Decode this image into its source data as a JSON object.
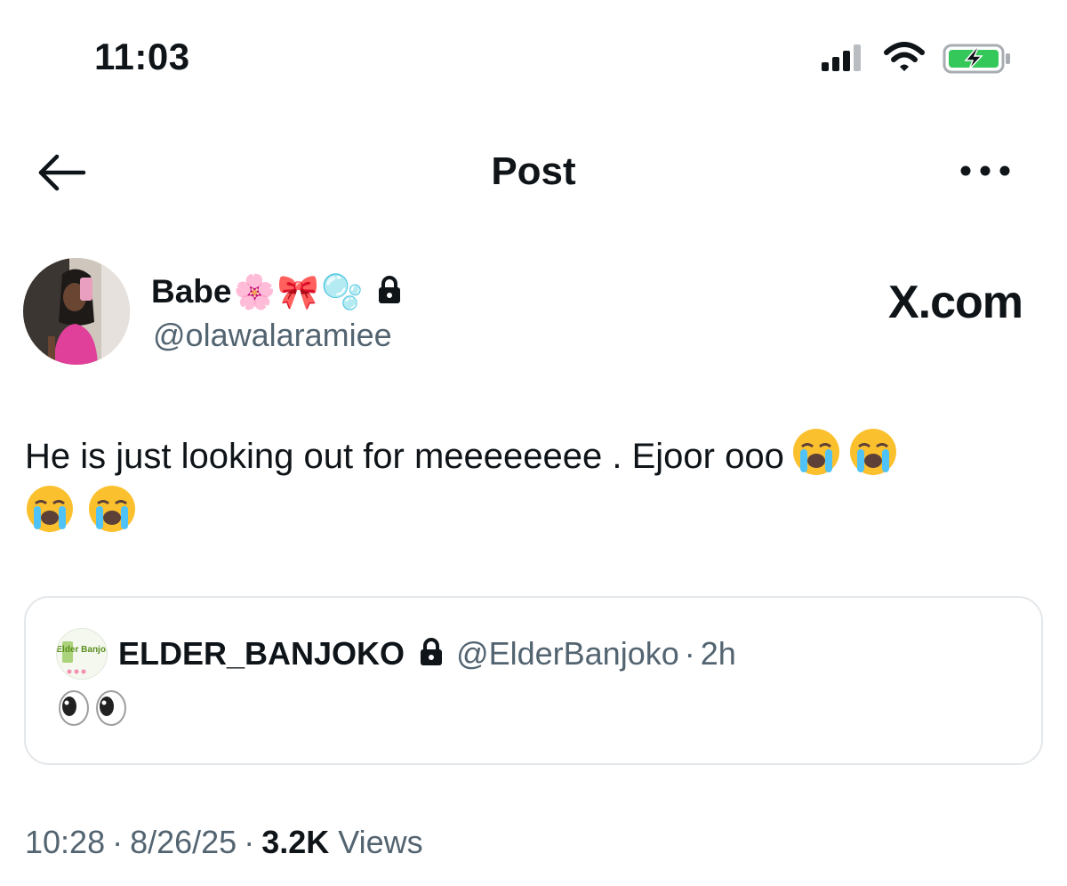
{
  "status_bar": {
    "time": "11:03",
    "icons": [
      "signal-icon",
      "wifi-icon",
      "battery-charging-icon"
    ],
    "battery_color": "#34c759"
  },
  "nav": {
    "title": "Post",
    "back_icon": "back-arrow-icon",
    "more_icon": "more-options-icon"
  },
  "post": {
    "author": {
      "display_name": "Babe",
      "name_emojis": [
        "🌸",
        "🎀",
        "🫧"
      ],
      "handle": "@olawalaramiee",
      "protected": true
    },
    "brand": "X.com",
    "text": "He is just looking out for meeeeeeee . Ejoor ooo",
    "trailing_emoji": "😭",
    "trailing_emoji_count": 4,
    "quoted": {
      "display_name": "ELDER_BANJOKO",
      "handle": "@ElderBanjoko",
      "separator": "·",
      "time": "2h",
      "protected": true,
      "avatar_text": "Elder Banjoko",
      "text": "👀"
    },
    "meta": {
      "time": "10:28",
      "date": "8/26/25",
      "separator": "·",
      "views_count": "3.2K",
      "views_label": "Views"
    }
  },
  "colors": {
    "text_primary": "#0f1419",
    "text_secondary": "#536471",
    "border": "#e3e7ea"
  }
}
